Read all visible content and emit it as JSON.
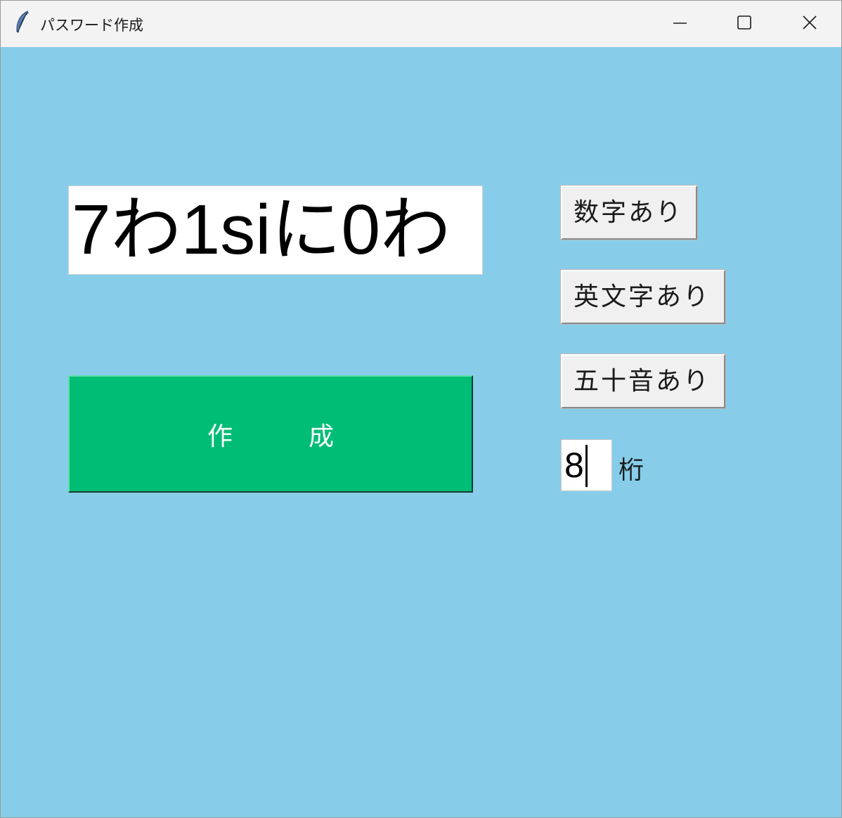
{
  "window": {
    "title": "パスワード作成",
    "background_color": "#87cdea",
    "icons": {
      "app": "feather-icon",
      "minimize": "minimize-icon",
      "maximize": "maximize-icon",
      "close": "close-icon"
    }
  },
  "password": {
    "value": "7わ1siに0わ"
  },
  "create_button": {
    "label": "作　　　成",
    "color": "#00bd75"
  },
  "options": {
    "numbers_label": "数字あり",
    "letters_label": "英文字あり",
    "kana_label": "五十音あり"
  },
  "digits": {
    "value": "8",
    "unit_label": "桁"
  }
}
